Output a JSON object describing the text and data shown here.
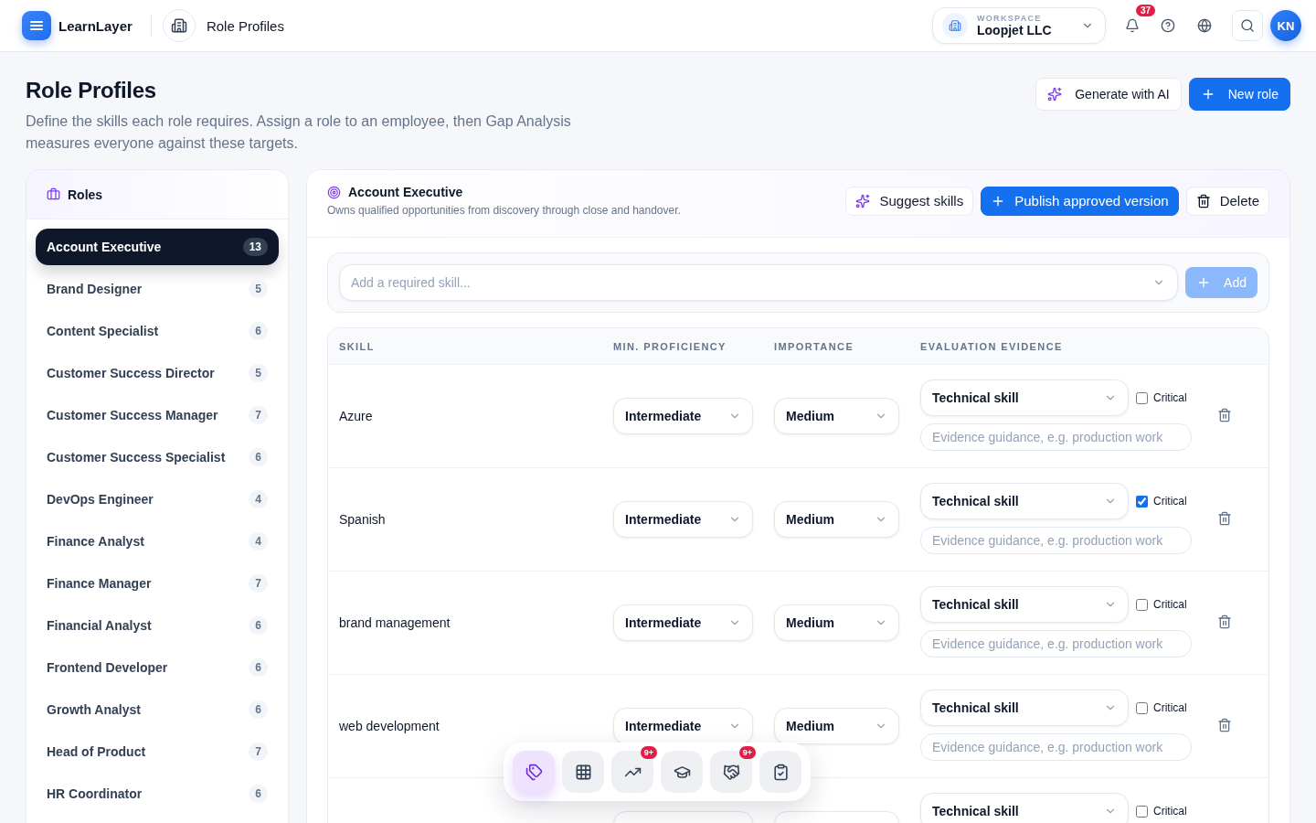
{
  "header": {
    "app_name": "LearnLayer",
    "page": "Role Profiles",
    "workspace": {
      "label": "WORKSPACE",
      "name": "Loopjet LLC"
    },
    "notifications": "37",
    "avatar": "KN"
  },
  "page": {
    "title": "Role Profiles",
    "description": "Define the skills each role requires. Assign a role to an employee, then Gap Analysis measures everyone against these targets.",
    "actions": [
      {
        "kind": "ai",
        "label": "Generate with AI"
      },
      {
        "kind": "primary",
        "label": "New role"
      }
    ]
  },
  "sidebar": {
    "title": "Roles",
    "items": [
      {
        "name": "Account Executive",
        "count": "13",
        "selected": true
      },
      {
        "name": "Brand Designer",
        "count": "5",
        "selected": false
      },
      {
        "name": "Content Specialist",
        "count": "6",
        "selected": false
      },
      {
        "name": "Customer Success Director",
        "count": "5",
        "selected": false
      },
      {
        "name": "Customer Success Manager",
        "count": "7",
        "selected": false
      },
      {
        "name": "Customer Success Specialist",
        "count": "6",
        "selected": false
      },
      {
        "name": "DevOps Engineer",
        "count": "4",
        "selected": false
      },
      {
        "name": "Finance Analyst",
        "count": "4",
        "selected": false
      },
      {
        "name": "Finance Manager",
        "count": "7",
        "selected": false
      },
      {
        "name": "Financial Analyst",
        "count": "6",
        "selected": false
      },
      {
        "name": "Frontend Developer",
        "count": "6",
        "selected": false
      },
      {
        "name": "Growth Analyst",
        "count": "6",
        "selected": false
      },
      {
        "name": "Head of Product",
        "count": "7",
        "selected": false
      },
      {
        "name": "HR Coordinator",
        "count": "6",
        "selected": false
      }
    ]
  },
  "role": {
    "title": "Account Executive",
    "description": "Owns qualified opportunities from discovery through close and handover.",
    "actions": [
      {
        "kind": "ai",
        "label": "Suggest skills"
      },
      {
        "kind": "primary",
        "label": "Publish approved version"
      },
      {
        "kind": "delete",
        "label": "Delete"
      }
    ],
    "add_skill": {
      "placeholder": "Add a required skill...",
      "button": "Add",
      "disabled": true
    },
    "columns": [
      "SKILL",
      "MIN. PROFICIENCY",
      "IMPORTANCE",
      "EVALUATION EVIDENCE"
    ],
    "rows": [
      {
        "skill": "Azure",
        "proficiency": "Intermediate",
        "importance": "Medium",
        "category": "Technical skill",
        "critical_label": "Critical",
        "critical": false,
        "evidence_placeholder": "Evidence guidance, e.g. production work"
      },
      {
        "skill": "Spanish",
        "proficiency": "Intermediate",
        "importance": "Medium",
        "category": "Technical skill",
        "critical_label": "Critical",
        "critical": true,
        "evidence_placeholder": "Evidence guidance, e.g. production work"
      },
      {
        "skill": "brand management",
        "proficiency": "Intermediate",
        "importance": "Medium",
        "category": "Technical skill",
        "critical_label": "Critical",
        "critical": false,
        "evidence_placeholder": "Evidence guidance, e.g. production work"
      },
      {
        "skill": "web development",
        "proficiency": "Intermediate",
        "importance": "Medium",
        "category": "Technical skill",
        "critical_label": "Critical",
        "critical": false,
        "evidence_placeholder": "Evidence guidance, e.g. production work"
      },
      {
        "category": "Technical skill",
        "critical_label": "Critical",
        "critical": false
      }
    ]
  },
  "dock": [
    {
      "kind": "tags",
      "selected": true
    },
    {
      "kind": "grid",
      "selected": false
    },
    {
      "kind": "trend",
      "selected": false,
      "badge": "9+"
    },
    {
      "kind": "learning",
      "selected": false
    },
    {
      "kind": "partners",
      "selected": false,
      "badge": "9+"
    },
    {
      "kind": "review",
      "selected": false
    }
  ]
}
